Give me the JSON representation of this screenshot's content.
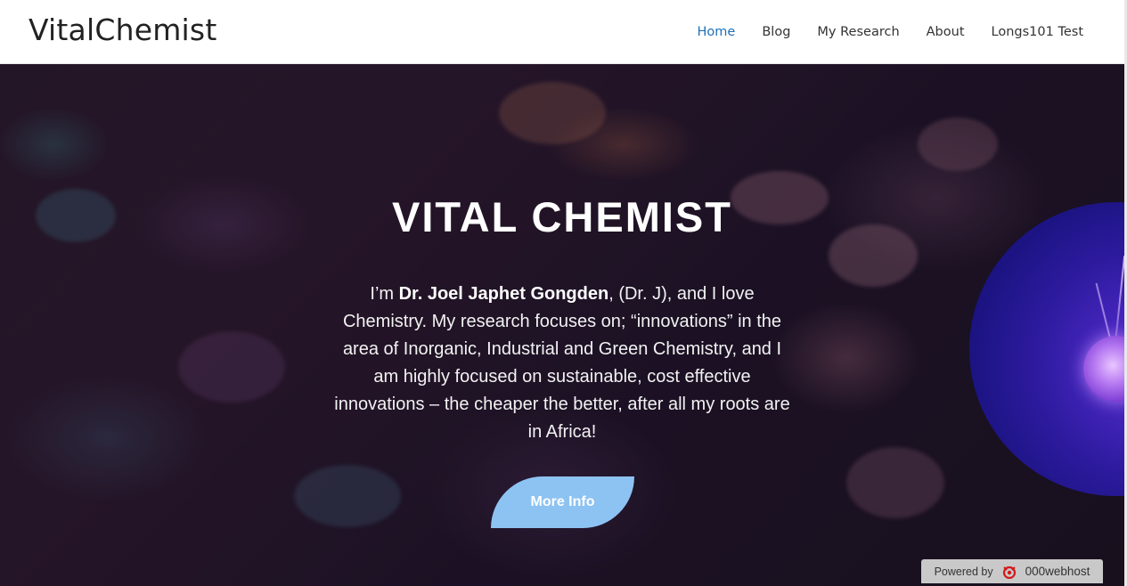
{
  "header": {
    "site_title": "VitalChemist",
    "nav": [
      {
        "label": "Home",
        "active": true
      },
      {
        "label": "Blog",
        "active": false
      },
      {
        "label": "My Research",
        "active": false
      },
      {
        "label": "About",
        "active": false
      },
      {
        "label": "Longs101 Test",
        "active": false
      }
    ]
  },
  "hero": {
    "title": "VITAL CHEMIST",
    "intro_prefix": "I’m ",
    "intro_name": "Dr. Joel Japhet Gongden",
    "intro_rest": ", (Dr. J), and I love Chemistry. My research focuses on; “innovations” in the area of Inorganic, Industrial and Green Chemistry, and I am highly focused on sustainable, cost effective innovations – the cheaper the better, after all my roots are in Africa!",
    "button_label": "More Info"
  },
  "footer_badge": {
    "prefix": "Powered by",
    "brand": "000webhost"
  },
  "colors": {
    "nav_active": "#1d70b8",
    "button_bg": "#8dc3f2",
    "hero_bg": "#2a1b2e"
  }
}
